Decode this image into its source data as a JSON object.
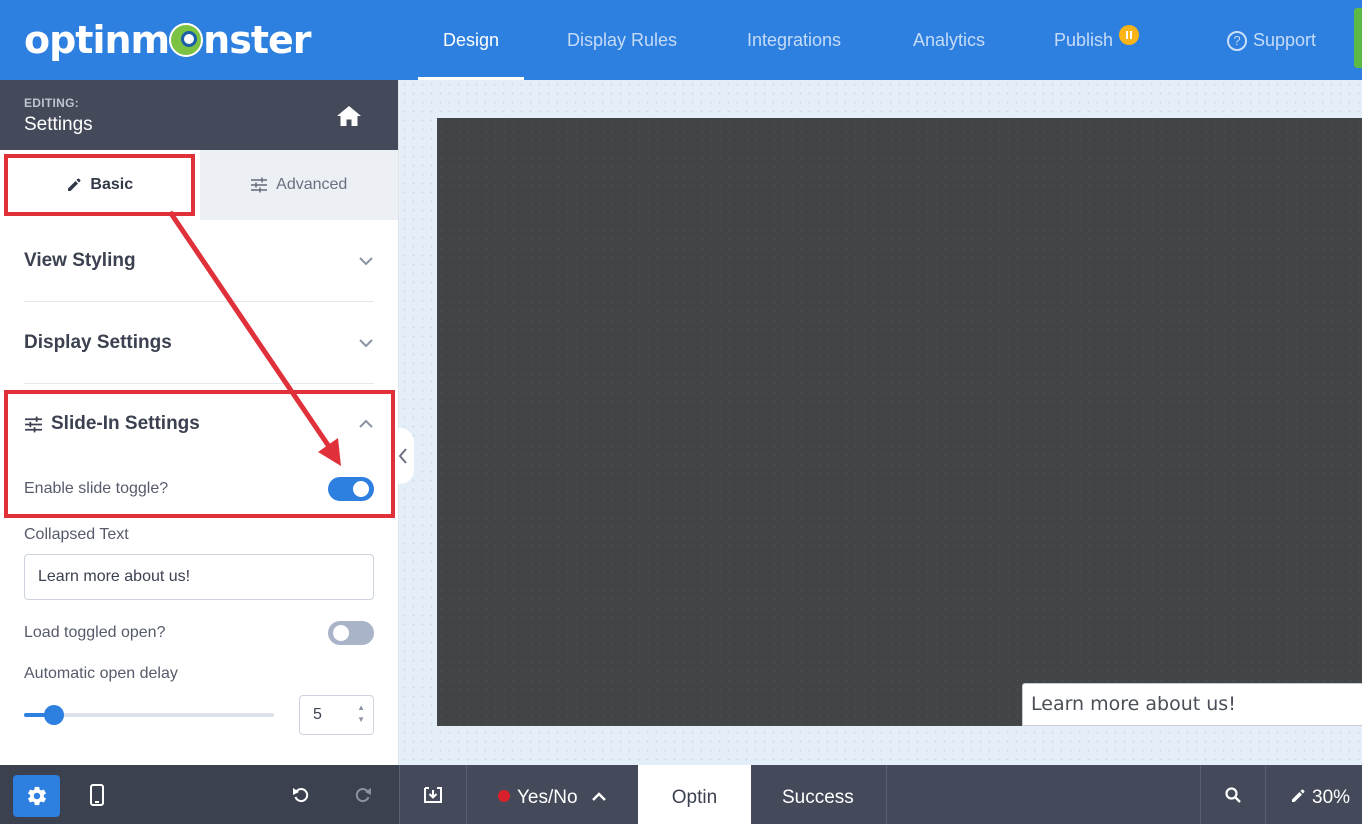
{
  "app": {
    "logo_text": "optinmonster"
  },
  "topnav": {
    "items": [
      {
        "label": "Design",
        "active": true
      },
      {
        "label": "Display Rules"
      },
      {
        "label": "Integrations"
      },
      {
        "label": "Analytics"
      },
      {
        "label": "Publish",
        "badge": "pause-icon"
      },
      {
        "label": "Support",
        "icon": "help-circle-icon"
      }
    ]
  },
  "sidebar": {
    "eyebrow": "EDITING:",
    "title": "Settings",
    "tabs": [
      {
        "label": "Basic",
        "icon": "pencil-icon",
        "active": true
      },
      {
        "label": "Advanced",
        "icon": "sliders-icon"
      }
    ],
    "sections": [
      {
        "label": "View Styling",
        "expanded": false
      },
      {
        "label": "Display Settings",
        "expanded": false
      },
      {
        "label": "Slide-In Settings",
        "expanded": true
      }
    ],
    "slide_in": {
      "enable_toggle_label": "Enable slide toggle?",
      "enable_toggle_on": true,
      "collapsed_text_label": "Collapsed Text",
      "collapsed_text_value": "Learn more about us!",
      "load_open_label": "Load toggled open?",
      "load_open_on": false,
      "delay_label": "Automatic open delay",
      "delay_value": "5",
      "delay_fraction": 0.12
    }
  },
  "canvas": {
    "slide_preview_text": "Learn more about us!"
  },
  "bottombar": {
    "status_label": "Yes/No",
    "tabs": [
      {
        "label": "Optin",
        "active": true
      },
      {
        "label": "Success"
      }
    ],
    "zoom": "30%"
  },
  "colors": {
    "primary": "#2d7fe0",
    "annotation": "#e0313b",
    "badge": "#f9b417",
    "dark": "#454a5a"
  }
}
